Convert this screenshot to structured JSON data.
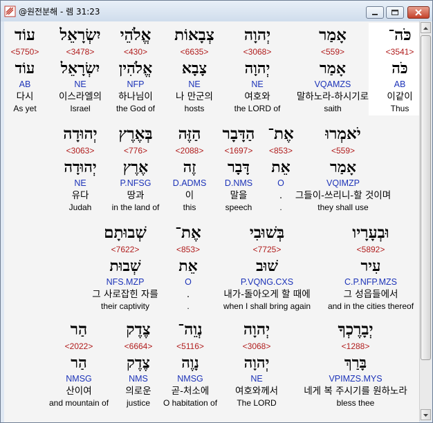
{
  "window": {
    "title": "@원전분해 - 렘 31:23"
  },
  "colors": {
    "strong": "#b01c1c",
    "morph": "#1c33b8",
    "text": "#000000",
    "highlight": "#ffffff"
  },
  "rows": [
    {
      "words": [
        {
          "hebrew": "כֹּה־",
          "strong": "<3541>",
          "lemma": "כֹּה",
          "morph": "AB",
          "korean": "이같이",
          "english": "Thus",
          "highlight": true
        },
        {
          "hebrew": "אָמַר",
          "strong": "<559>",
          "lemma": "אָמַר",
          "morph": "VQAMZS",
          "korean": "말하노라-하시기로",
          "english": "saith"
        },
        {
          "hebrew": "יְהוָה",
          "strong": "<3068>",
          "lemma": "יְהוָה",
          "morph": "NE",
          "korean": "여호와",
          "english": "the LORD of"
        },
        {
          "hebrew": "צְבָאוֹת",
          "strong": "<6635>",
          "lemma": "צָבָא",
          "morph": "NE",
          "korean": "나 만군의",
          "english": "hosts"
        },
        {
          "hebrew": "אֱלֹהֵי",
          "strong": "<430>",
          "lemma": "אֱלֹהִין",
          "morph": "NFP",
          "korean": "하나님이",
          "english": "the God of"
        },
        {
          "hebrew": "יִשְׂרָאֵל",
          "strong": "<3478>",
          "lemma": "יִשְׂרָאֵל",
          "morph": "NE",
          "korean": "이스라엘의",
          "english": "Israel"
        },
        {
          "hebrew": "עוֹד",
          "strong": "<5750>",
          "lemma": "עוֹד",
          "morph": "AB",
          "korean": "다시",
          "english": "As yet"
        }
      ]
    },
    {
      "words": [
        {
          "hebrew": "יֹאמְרוּ",
          "strong": "<559>",
          "lemma": "אָמַר",
          "morph": "VQIMZP",
          "korean": "그들이-쓰리니-할 것이며",
          "english": "they shall use"
        },
        {
          "hebrew": "אֶת־",
          "strong": "<853>",
          "lemma": "אֵת",
          "morph": "O",
          "korean": ".",
          "english": "."
        },
        {
          "hebrew": "הַדָּבָר",
          "strong": "<1697>",
          "lemma": "דָּבָר",
          "morph": "D.NMS",
          "korean": "말을",
          "english": "speech"
        },
        {
          "hebrew": "הַזֶּה",
          "strong": "<2088>",
          "lemma": "זֶה",
          "morph": "D.ADMS",
          "korean": "이",
          "english": "this"
        },
        {
          "hebrew": "בְּאֶרֶץ",
          "strong": "<776>",
          "lemma": "אֶרֶץ",
          "morph": "P.NFSG",
          "korean": "땅과",
          "english": "in the land of"
        },
        {
          "hebrew": "יְהוּדָה",
          "strong": "<3063>",
          "lemma": "יְהוּדָה",
          "morph": "NE",
          "korean": "유다",
          "english": "Judah"
        }
      ]
    },
    {
      "words": [
        {
          "hebrew": "וּבְעָרָיו",
          "strong": "<5892>",
          "lemma": "עִיר",
          "morph": "C.P.NFP.MZS",
          "korean": "그 성읍들에서",
          "english": "and in the cities thereof"
        },
        {
          "hebrew": "בְּשׁוּבִי",
          "strong": "<7725>",
          "lemma": "שׁוּב",
          "morph": "P.VQNG.CXS",
          "korean": "내가-돌아오게 할 때에",
          "english": "when I shall bring again"
        },
        {
          "hebrew": "אֶת־",
          "strong": "<853>",
          "lemma": "אֵת",
          "morph": "O",
          "korean": ".",
          "english": "."
        },
        {
          "hebrew": "שְׁבוּתָם",
          "strong": "<7622>",
          "lemma": "שְׁבוּת",
          "morph": "NFS.MZP",
          "korean": "그 사로잡힌 자를",
          "english": "their captivity"
        }
      ]
    },
    {
      "words": [
        {
          "hebrew": "יְבָרֶכְךָ",
          "strong": "<1288>",
          "lemma": "בָּרַךְ",
          "morph": "VPIMZS.MYS",
          "korean": "네게 복 주시기를 원하노라",
          "english": "bless thee"
        },
        {
          "hebrew": "יְהוָה",
          "strong": "<3068>",
          "lemma": "יְהוָה",
          "morph": "NE",
          "korean": "여호와께서",
          "english": "The LORD"
        },
        {
          "hebrew": "נְוֵה־",
          "strong": "<5116>",
          "lemma": "נָוֶה",
          "morph": "NMSG",
          "korean": "곧-처소에",
          "english": "O habitation of"
        },
        {
          "hebrew": "צֶדֶק",
          "strong": "<6664>",
          "lemma": "צֶדֶק",
          "morph": "NMS",
          "korean": "의로운",
          "english": "justice"
        },
        {
          "hebrew": "הַר",
          "strong": "<2022>",
          "lemma": "הַר",
          "morph": "NMSG",
          "korean": "산이여",
          "english": "and mountain of"
        }
      ]
    }
  ]
}
